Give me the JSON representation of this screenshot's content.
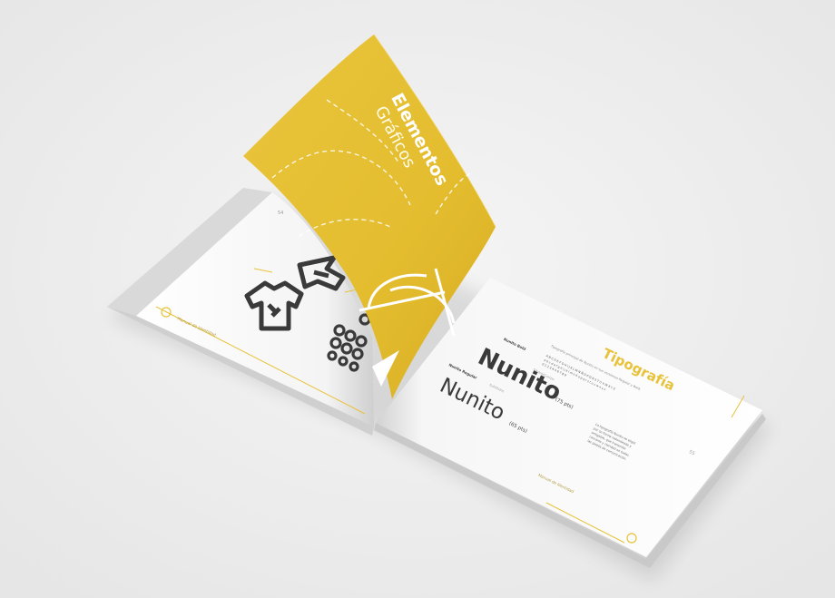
{
  "photo": {
    "subject": "open hardcover brand manual mockup with turning yellow page",
    "background_color": "#efefef",
    "accent_color": "#e8c23a",
    "page_color": "#ffffff",
    "ink_color": "#333333"
  },
  "turning_page": {
    "title_line1": "Elementos",
    "title_line2": "Gráficos"
  },
  "left_page": {
    "page_number": "54",
    "footer_label": "Manual de Identidad",
    "icons": [
      "t-shirt-icon",
      "hanger-icon",
      "bubbles-icon"
    ]
  },
  "right_page": {
    "heading": "Tipografía",
    "intro": "Tipografía principal de Nunito en sus versiones Regular y Bold.",
    "bold_label": "Nunito Bold",
    "bold_sample": "Nunito",
    "bold_size": "(75 pts)",
    "bold_caption": "Títulos/Cuerpo",
    "bold_alphabet_upper": "A B C D E F G H I J K L M N Ñ O P Q R S T U V W X Y Z",
    "bold_alphabet_lower": "a b c d e f g h i j k l m n ñ o p q r s t u v w x y z",
    "bold_digits": "0 1 2 3 4 5 6 7 8 9",
    "regular_label": "Nunito Regular",
    "regular_sample": "Nunito",
    "regular_size": "(65 pts)",
    "regular_caption": "Subtítulos",
    "body_text": "La tipografía Nunito se eligió por su forma redondeada y amigable, que transmite cercanía y claridad en todas las piezas de comunicación.",
    "page_number": "55",
    "footer_label": "Manual de Identidad"
  }
}
